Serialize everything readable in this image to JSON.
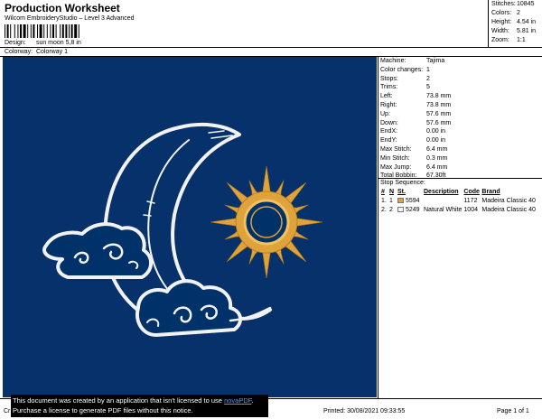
{
  "header": {
    "title": "Production Worksheet",
    "subtitle": "Wilcom EmbroideryStudio – Level 3 Advanced",
    "design_label": "Design:",
    "design_value": "sun moon 5,8 in",
    "colorway_label": "Colorway:",
    "colorway_value": "Colorway 1"
  },
  "summary": [
    {
      "label": "Stitches:",
      "value": "10845"
    },
    {
      "label": "Colors:",
      "value": "2"
    },
    {
      "label": "Height:",
      "value": "4.54 in"
    },
    {
      "label": "Width:",
      "value": "5.81 in"
    },
    {
      "label": "Zoom:",
      "value": "1:1"
    }
  ],
  "machine_info": [
    {
      "label": "Machine:",
      "value": "Tajima"
    },
    {
      "label": "Color changes:",
      "value": "1"
    },
    {
      "label": "Stops:",
      "value": "2"
    },
    {
      "label": "Trims:",
      "value": "5"
    },
    {
      "label": "Left:",
      "value": "73.8 mm"
    },
    {
      "label": "Right:",
      "value": "73.8 mm"
    },
    {
      "label": "Up:",
      "value": "57.6 mm"
    },
    {
      "label": "Down:",
      "value": "57.6 mm"
    },
    {
      "label": "EndX:",
      "value": "0.00 in"
    },
    {
      "label": "EndY:",
      "value": "0.00 in"
    },
    {
      "label": "Max Stitch:",
      "value": "6.4 mm"
    },
    {
      "label": "Min Stitch:",
      "value": "0.3 mm"
    },
    {
      "label": "Max Jump:",
      "value": "6.4 mm"
    },
    {
      "label": "Total Bobbin:",
      "value": "67.30ft"
    }
  ],
  "stop_sequence": {
    "title": "Stop Sequence:",
    "headers": [
      "#",
      "N",
      "St.",
      "Description",
      "Code",
      "Brand"
    ],
    "rows": [
      {
        "num": "1.",
        "n": "1",
        "color": "#e0a23a",
        "st": "5594",
        "description": "",
        "code": "1172",
        "brand": "Madeira Classic 40"
      },
      {
        "num": "2.",
        "n": "2",
        "color": "#f2f2f2",
        "st": "5249",
        "description": "Natural White",
        "code": "1004",
        "brand": "Madeira Classic 40"
      }
    ]
  },
  "design_colors": {
    "background": "#06316a",
    "thread_1": "#e0a23a",
    "thread_2": "#f2f2f2"
  },
  "notice": {
    "line1": "This document was created by an application that isn't licensed to use ",
    "link": "novaPDF",
    "line1_end": ".",
    "line2": "Purchase a license to generate PDF files without this notice."
  },
  "footer": {
    "left": "Cr",
    "printed": "Printed: 30/08/2021 09:33:55",
    "page": "Page 1 of 1"
  }
}
